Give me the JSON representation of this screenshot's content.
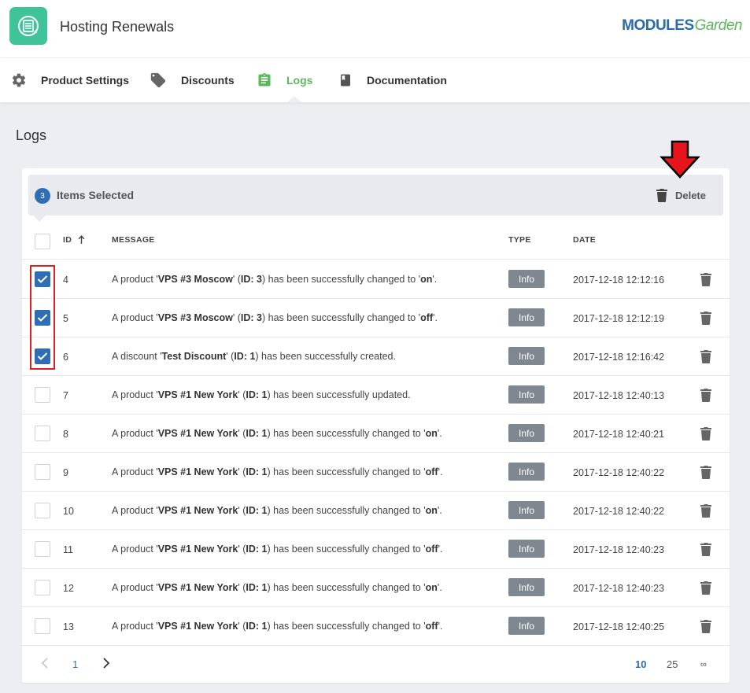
{
  "app": {
    "title": "Hosting Renewals",
    "brand_main": "MODULES",
    "brand_sub": "Garden",
    "icon": "renewal-server-icon",
    "accent_color": "#3fc49a"
  },
  "tabs": [
    {
      "label": "Product Settings",
      "icon": "gear-icon"
    },
    {
      "label": "Discounts",
      "icon": "tag-icon"
    },
    {
      "label": "Logs",
      "icon": "clipboard-icon"
    },
    {
      "label": "Documentation",
      "icon": "book-icon"
    }
  ],
  "active_tab": "Logs",
  "page": {
    "title": "Logs"
  },
  "selection": {
    "count": "3",
    "label": "Items Selected",
    "delete_label": "Delete"
  },
  "table": {
    "headers": {
      "id": "ID",
      "message": "MESSAGE",
      "type": "TYPE",
      "date": "DATE"
    },
    "sort_icon": "arrow-up-icon",
    "rows": [
      {
        "checked": true,
        "id": "4",
        "m1": "A product '",
        "b1": "VPS #3 Moscow",
        "m2": "' (",
        "b2": "ID: 3",
        "m3": ") has been successfully changed to '",
        "b3": "on",
        "m4": "'.",
        "type": "Info",
        "date": "2017-12-18 12:12:16"
      },
      {
        "checked": true,
        "id": "5",
        "m1": "A product '",
        "b1": "VPS #3 Moscow",
        "m2": "' (",
        "b2": "ID: 3",
        "m3": ") has been successfully changed to '",
        "b3": "off",
        "m4": "'.",
        "type": "Info",
        "date": "2017-12-18 12:12:19"
      },
      {
        "checked": true,
        "id": "6",
        "m1": "A discount '",
        "b1": "Test Discount",
        "m2": "' (",
        "b2": "ID: 1",
        "m3": ") has been successfully created.",
        "b3": "",
        "m4": "",
        "type": "Info",
        "date": "2017-12-18 12:16:42"
      },
      {
        "checked": false,
        "id": "7",
        "m1": "A product '",
        "b1": "VPS #1 New York",
        "m2": "' (",
        "b2": "ID: 1",
        "m3": ") has been successfully updated.",
        "b3": "",
        "m4": "",
        "type": "Info",
        "date": "2017-12-18 12:40:13"
      },
      {
        "checked": false,
        "id": "8",
        "m1": "A product '",
        "b1": "VPS #1 New York",
        "m2": "' (",
        "b2": "ID: 1",
        "m3": ") has been successfully changed to '",
        "b3": "on",
        "m4": "'.",
        "type": "Info",
        "date": "2017-12-18 12:40:21"
      },
      {
        "checked": false,
        "id": "9",
        "m1": "A product '",
        "b1": "VPS #1 New York",
        "m2": "' (",
        "b2": "ID: 1",
        "m3": ") has been successfully changed to '",
        "b3": "off",
        "m4": "'.",
        "type": "Info",
        "date": "2017-12-18 12:40:22"
      },
      {
        "checked": false,
        "id": "10",
        "m1": "A product '",
        "b1": "VPS #1 New York",
        "m2": "' (",
        "b2": "ID: 1",
        "m3": ") has been successfully changed to '",
        "b3": "on",
        "m4": "'.",
        "type": "Info",
        "date": "2017-12-18 12:40:22"
      },
      {
        "checked": false,
        "id": "11",
        "m1": "A product '",
        "b1": "VPS #1 New York",
        "m2": "' (",
        "b2": "ID: 1",
        "m3": ") has been successfully changed to '",
        "b3": "off",
        "m4": "'.",
        "type": "Info",
        "date": "2017-12-18 12:40:23"
      },
      {
        "checked": false,
        "id": "12",
        "m1": "A product '",
        "b1": "VPS #1 New York",
        "m2": "' (",
        "b2": "ID: 1",
        "m3": ") has been successfully changed to '",
        "b3": "on",
        "m4": "'.",
        "type": "Info",
        "date": "2017-12-18 12:40:23"
      },
      {
        "checked": false,
        "id": "13",
        "m1": "A product '",
        "b1": "VPS #1 New York",
        "m2": "' (",
        "b2": "ID: 1",
        "m3": ") has been successfully changed to '",
        "b3": "off",
        "m4": "'.",
        "type": "Info",
        "date": "2017-12-18 12:40:25"
      }
    ]
  },
  "pagination": {
    "current_page": "1",
    "page_sizes": [
      "10",
      "25",
      "∞"
    ],
    "active_size": "10",
    "prev_icon": "chevron-left-icon",
    "next_icon": "chevron-right-icon"
  },
  "colors": {
    "primary": "#2f6eb5",
    "active_tab": "#5cb85c",
    "badge": "#7f8791",
    "annotation": "#e02020"
  }
}
